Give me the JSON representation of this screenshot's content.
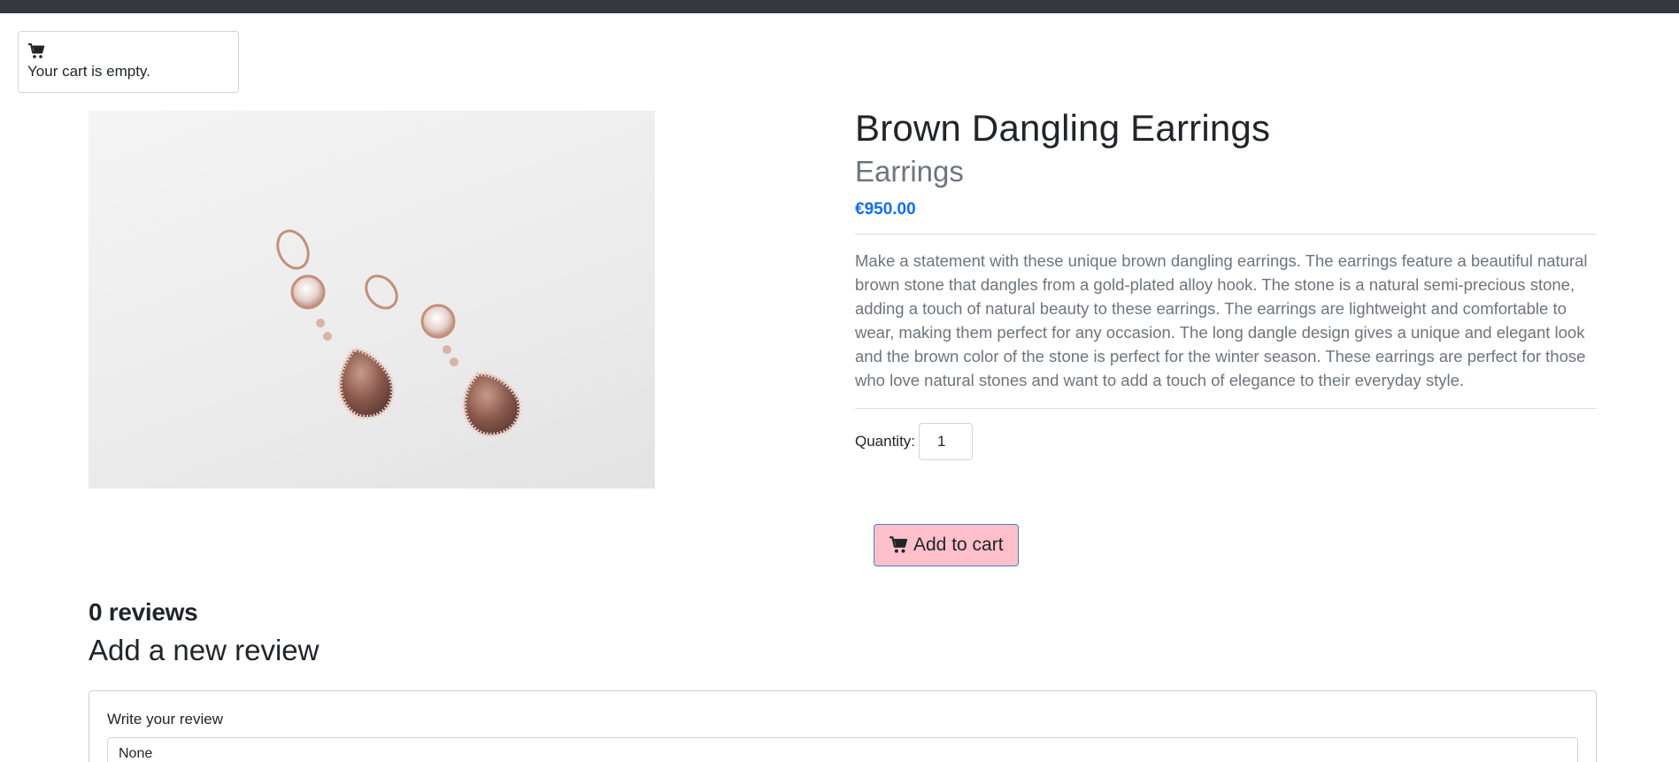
{
  "cart": {
    "icon": "cart-icon",
    "status_text": "Your cart is empty."
  },
  "product": {
    "image_alt": "Rose gold teardrop dangling earrings",
    "title": "Brown Dangling Earrings",
    "category": "Earrings",
    "price": "€950.00",
    "description": "Make a statement with these unique brown dangling earrings. The earrings feature a beautiful natural brown stone that dangles from a gold-plated alloy hook. The stone is a natural semi-precious stone, adding a touch of natural beauty to these earrings. The earrings are lightweight and comfortable to wear, making them perfect for any occasion. The long dangle design gives a unique and elegant look and the brown color of the stone is perfect for the winter season. These earrings are perfect for those who love natural stones and want to add a touch of elegance to their everyday style."
  },
  "quantity": {
    "label": "Quantity:",
    "value": "1"
  },
  "add_to_cart": {
    "icon": "cart-icon",
    "label": "Add to cart"
  },
  "reviews": {
    "count_text": "0 reviews",
    "add_title": "Add a new review",
    "form_label": "Write your review",
    "input_value": "None"
  },
  "colors": {
    "topbar": "#343a40",
    "price": "#0d6efd",
    "button_bg": "#ffc0cb",
    "button_border": "#4a7fd4",
    "muted_text": "#6c757d"
  }
}
